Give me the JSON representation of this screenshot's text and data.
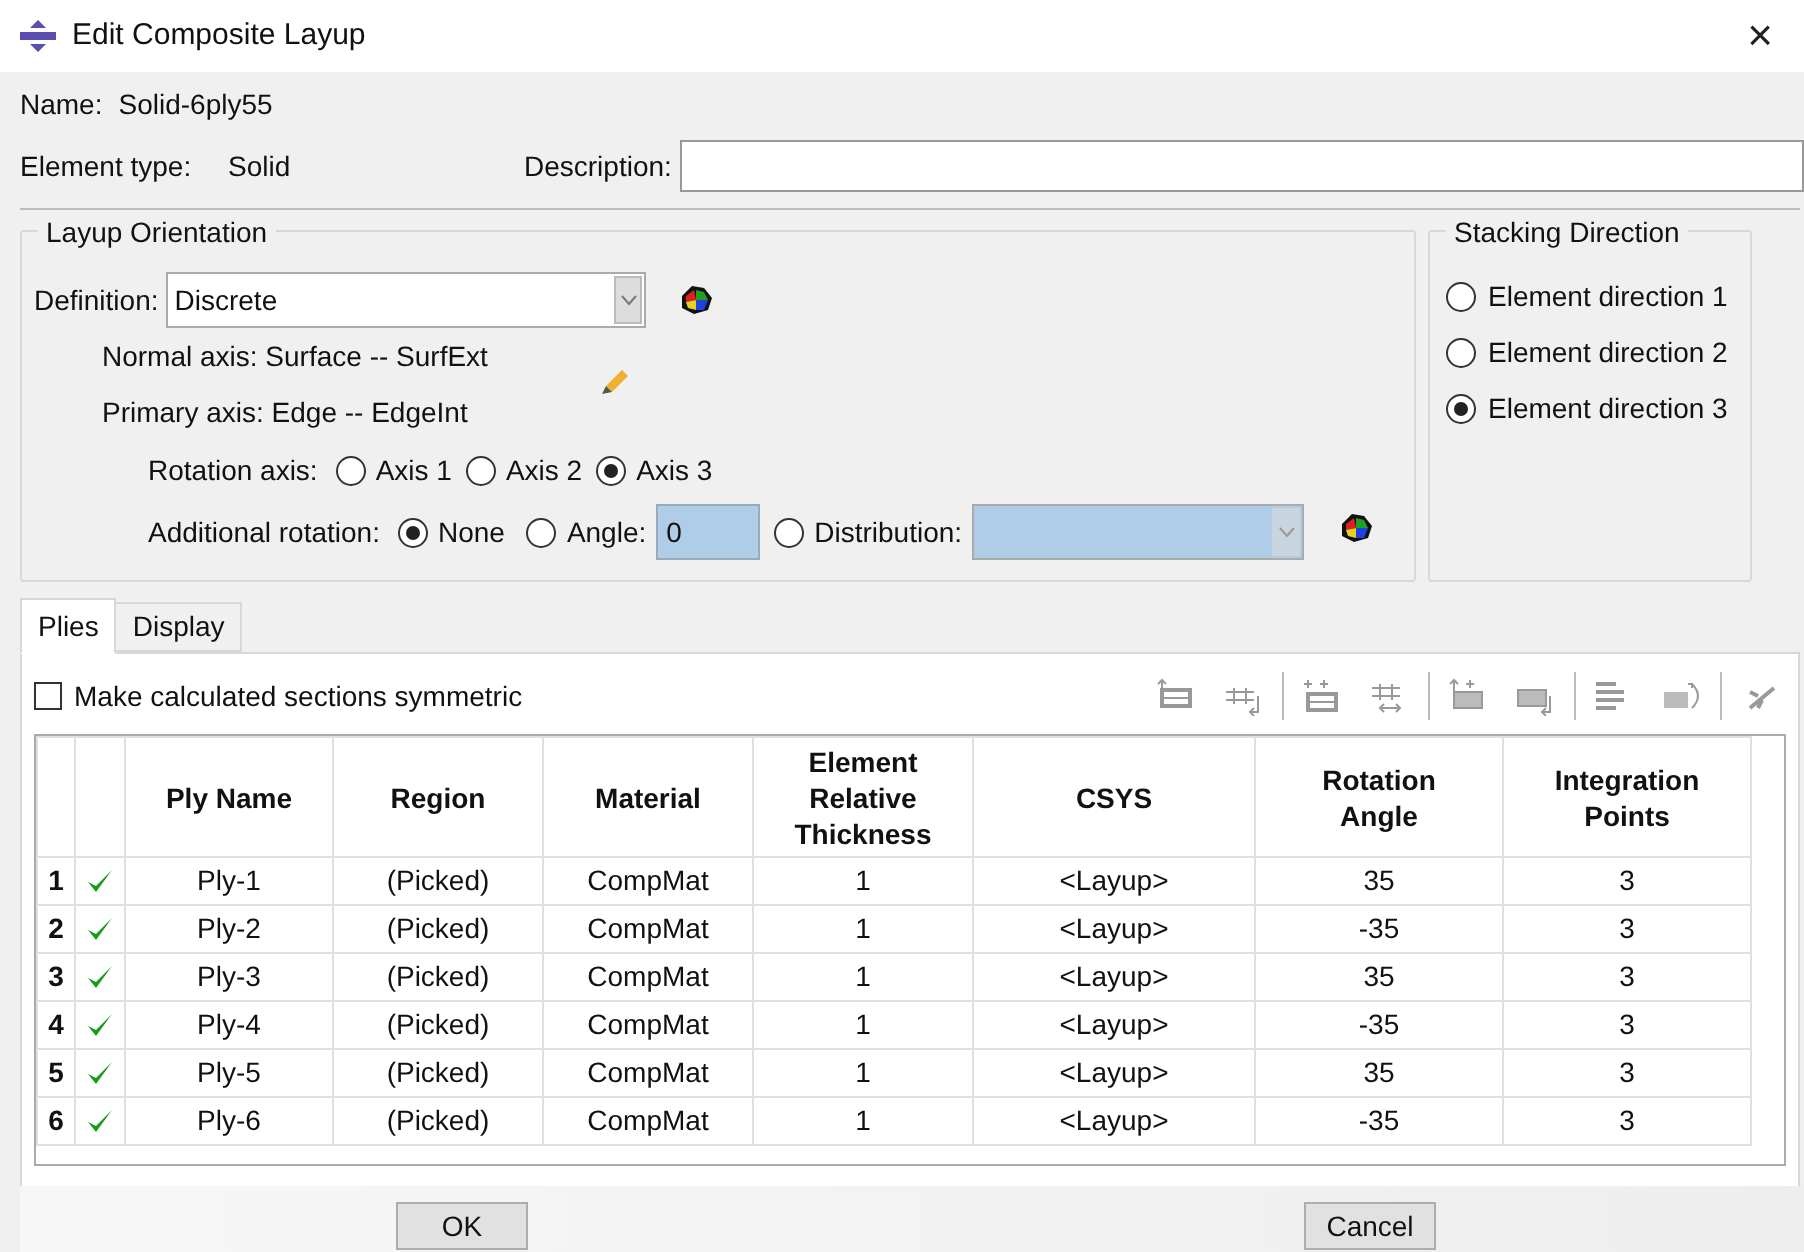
{
  "window": {
    "title": "Edit Composite Layup",
    "close": "×"
  },
  "name": {
    "label": "Name:",
    "value": "Solid-6ply55"
  },
  "element_type": {
    "label": "Element type:",
    "value": "Solid"
  },
  "description": {
    "label": "Description:"
  },
  "layup_orientation": {
    "title": "Layup Orientation",
    "definition_label": "Definition:",
    "definition_value": "Discrete",
    "normal_axis": "Normal axis: Surface -- SurfExt",
    "primary_axis": "Primary axis: Edge -- EdgeInt",
    "rotation_axis_label": "Rotation axis:",
    "rotation_axis_options": [
      {
        "label": "Axis 1",
        "selected": false
      },
      {
        "label": "Axis 2",
        "selected": false
      },
      {
        "label": "Axis 3",
        "selected": true
      }
    ],
    "additional_rotation_label": "Additional rotation:",
    "additional_rotation_options": [
      {
        "kind": "plain",
        "label": "None",
        "selected": true
      },
      {
        "kind": "angle",
        "label": "Angle:",
        "selected": false,
        "value": "0"
      },
      {
        "kind": "distribution",
        "label": "Distribution:",
        "selected": false
      }
    ]
  },
  "stacking_direction": {
    "title": "Stacking Direction",
    "options": [
      {
        "label": "Element direction 1",
        "selected": false
      },
      {
        "label": "Element direction 2",
        "selected": false
      },
      {
        "label": "Element direction 3",
        "selected": true
      }
    ]
  },
  "tabs": [
    {
      "label": "Plies",
      "selected": true
    },
    {
      "label": "Display",
      "selected": false
    }
  ],
  "symmetric": {
    "label": "Make calculated sections symmetric",
    "checked": false
  },
  "table": {
    "columns": [
      "Ply Name",
      "Region",
      "Material",
      "Element Relative Thickness",
      "CSYS",
      "Rotation Angle",
      "Integration Points"
    ],
    "rows": [
      {
        "index": "1",
        "checked": true,
        "cells": [
          "Ply-1",
          "(Picked)",
          "CompMat",
          "1",
          "<Layup>",
          "35",
          "3"
        ]
      },
      {
        "index": "2",
        "checked": true,
        "cells": [
          "Ply-2",
          "(Picked)",
          "CompMat",
          "1",
          "<Layup>",
          "-35",
          "3"
        ]
      },
      {
        "index": "3",
        "checked": true,
        "cells": [
          "Ply-3",
          "(Picked)",
          "CompMat",
          "1",
          "<Layup>",
          "35",
          "3"
        ]
      },
      {
        "index": "4",
        "checked": true,
        "cells": [
          "Ply-4",
          "(Picked)",
          "CompMat",
          "1",
          "<Layup>",
          "-35",
          "3"
        ]
      },
      {
        "index": "5",
        "checked": true,
        "cells": [
          "Ply-5",
          "(Picked)",
          "CompMat",
          "1",
          "<Layup>",
          "35",
          "3"
        ]
      },
      {
        "index": "6",
        "checked": true,
        "cells": [
          "Ply-6",
          "(Picked)",
          "CompMat",
          "1",
          "<Layup>",
          "-35",
          "3"
        ]
      }
    ]
  },
  "buttons": [
    "OK",
    "Cancel"
  ]
}
